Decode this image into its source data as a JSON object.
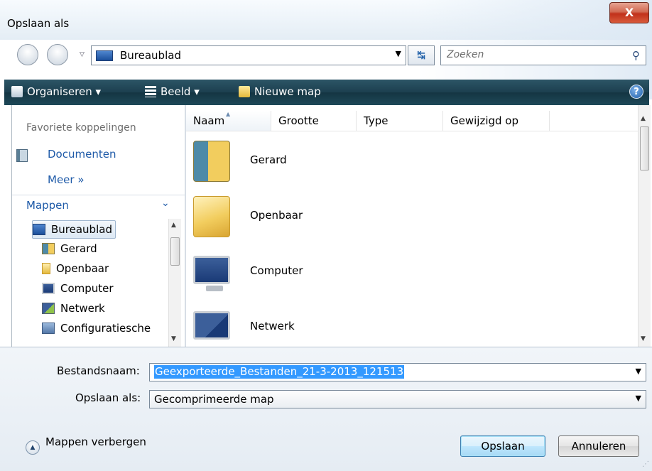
{
  "window": {
    "title": "Opslaan als",
    "close_symbol": "X"
  },
  "address": {
    "location": "Bureaublad",
    "search_placeholder": "Zoeken"
  },
  "toolbar": {
    "organize": "Organiseren",
    "view": "Beeld",
    "new_folder": "Nieuwe map",
    "help": "?"
  },
  "favorites": {
    "header": "Favoriete koppelingen",
    "documents": "Documenten",
    "more": "Meer  »"
  },
  "folders": {
    "header": "Mappen",
    "items": [
      {
        "label": "Bureaublad"
      },
      {
        "label": "Gerard"
      },
      {
        "label": "Openbaar"
      },
      {
        "label": "Computer"
      },
      {
        "label": "Netwerk"
      },
      {
        "label": "Configuratiesche"
      }
    ]
  },
  "list": {
    "columns": [
      "Naam",
      "Grootte",
      "Type",
      "Gewijzigd op"
    ],
    "files": [
      {
        "name": "Gerard",
        "icon": "user-folder-icon"
      },
      {
        "name": "Openbaar",
        "icon": "folder-icon"
      },
      {
        "name": "Computer",
        "icon": "computer-icon"
      },
      {
        "name": "Netwerk",
        "icon": "network-icon"
      }
    ]
  },
  "form": {
    "filename_label": "Bestandsnaam:",
    "filename_value": "Geexporteerde_Bestanden_21-3-2013_121513",
    "savetype_label": "Opslaan als:",
    "savetype_value": "Gecomprimeerde map"
  },
  "footer": {
    "hide_folders": "Mappen verbergen",
    "save": "Opslaan",
    "cancel": "Annuleren"
  },
  "colors": {
    "toolbar": "#1c3f4f",
    "link": "#1e5aa8",
    "selection": "#3399ff",
    "close": "#c1301a"
  }
}
